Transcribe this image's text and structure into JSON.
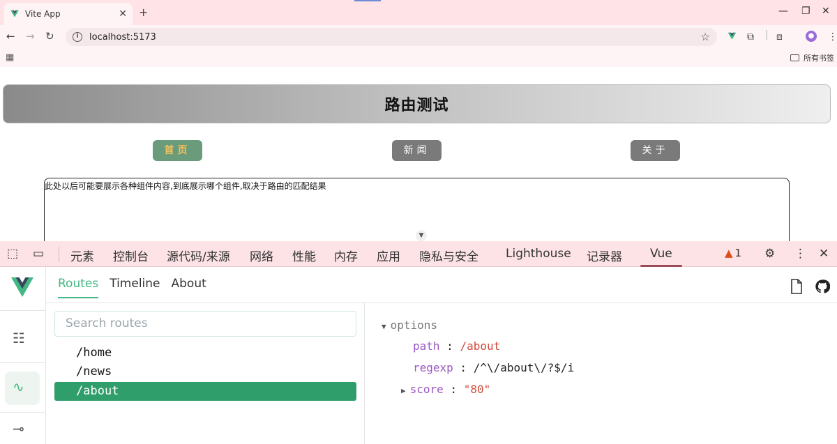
{
  "browser": {
    "tab_title": "Vite App",
    "address": "localhost:5173",
    "bookmarks_label": "所有书签"
  },
  "page": {
    "heading": "路由测试",
    "nav": [
      {
        "label": "首页",
        "active": true
      },
      {
        "label": "新闻",
        "active": false
      },
      {
        "label": "关于",
        "active": false
      }
    ],
    "content_text": "此处以后可能要展示各种组件内容,到底展示哪个组件,取决于路由的匹配结果"
  },
  "devtools": {
    "tabs": [
      "元素",
      "控制台",
      "源代码/来源",
      "网络",
      "性能",
      "内存",
      "应用",
      "隐私与安全",
      "Lighthouse",
      "记录器",
      "Vue"
    ],
    "active_tab": "Vue",
    "warning_count": "1"
  },
  "vue_devtools": {
    "tabs": [
      "Routes",
      "Timeline",
      "About"
    ],
    "active_tab": "Routes",
    "search_placeholder": "Search routes",
    "routes": [
      "/home",
      "/news",
      "/about"
    ],
    "selected_route": "/about",
    "detail": {
      "section": "options",
      "path_key": "path",
      "path_value": "/about",
      "regexp_key": "regexp",
      "regexp_value": "/^\\/about\\/?$/i",
      "score_key": "score",
      "score_value": "\"80\""
    }
  },
  "colors": {
    "vue_green": "#42b883",
    "selected_row": "#2f9e6a",
    "active_nav_bg": "#6a9c7c",
    "active_nav_text": "#f6c15a"
  }
}
